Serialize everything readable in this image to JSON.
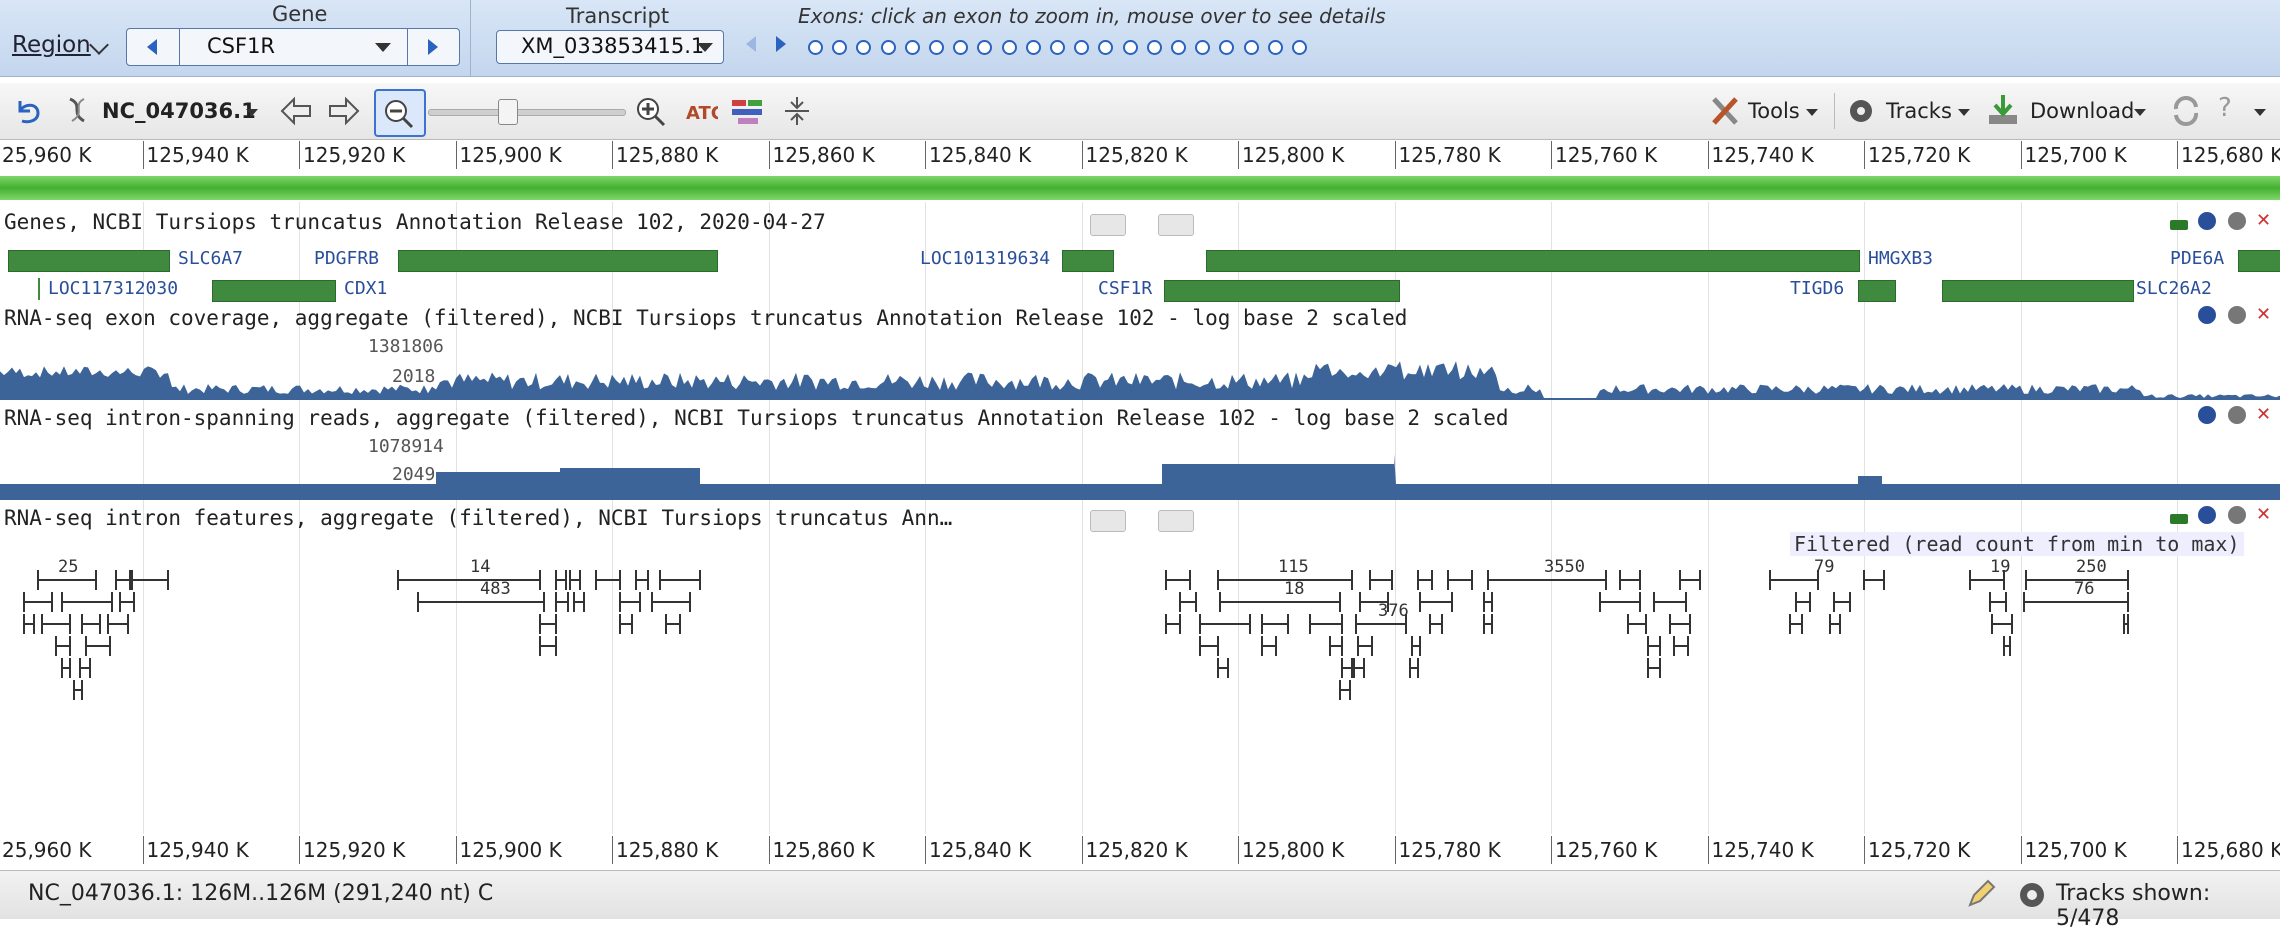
{
  "header": {
    "region_label": "Region",
    "gene_label": "Gene",
    "gene_value": "CSF1R",
    "transcript_label": "Transcript",
    "transcript_value": "XM_033853415.1",
    "exon_hint": "Exons: click an exon to zoom in, mouse over to see details"
  },
  "toolbar": {
    "sequence": "NC_047036.1",
    "tools_label": "Tools",
    "tracks_label": "Tracks",
    "download_label": "Download"
  },
  "ruler": {
    "labels": [
      "25,960 K",
      "125,940 K",
      "125,920 K",
      "125,900 K",
      "125,880 K",
      "125,860 K",
      "125,840 K",
      "125,820 K",
      "125,800 K",
      "125,780 K",
      "125,760 K",
      "125,740 K",
      "125,720 K",
      "125,700 K",
      "125,680 K"
    ]
  },
  "tracks": {
    "genes_title": "Genes, NCBI Tursiops truncatus Annotation Release 102, 2020-04-27",
    "gene_labels": [
      "SLC6A7",
      "PDGFRB",
      "LOC101319634",
      "HMGXB3",
      "PDE6A",
      "LOC117312030",
      "CDX1",
      "CSF1R",
      "TIGD6",
      "SLC26A2"
    ],
    "exon_cov_title": "RNA-seq exon coverage, aggregate (filtered), NCBI Tursiops truncatus Annotation Release 102 - log base 2 scaled",
    "exon_cov_max": "1381806",
    "exon_cov_mid": "2018",
    "intron_span_title": "RNA-seq intron-spanning reads, aggregate (filtered), NCBI Tursiops truncatus Annotation Release 102 - log base 2 scaled",
    "intron_span_max": "1078914",
    "intron_span_mid": "2049",
    "intron_feat_title": "RNA-seq intron features, aggregate (filtered), NCBI Tursiops truncatus Ann…",
    "filtered_note": "Filtered (read count from min to max)",
    "intron_counts": [
      "25",
      "14",
      "483",
      "115",
      "18",
      "376",
      "3550",
      "79",
      "19",
      "250",
      "76"
    ]
  },
  "status": {
    "location": "NC_047036.1: 126M..126M (291,240 nt) C",
    "tracks_shown": "Tracks shown: 5/478"
  },
  "colors": {
    "gene_bar": "#3f8a3f",
    "coverage": "#3c6498",
    "accent": "#2a62c0"
  }
}
